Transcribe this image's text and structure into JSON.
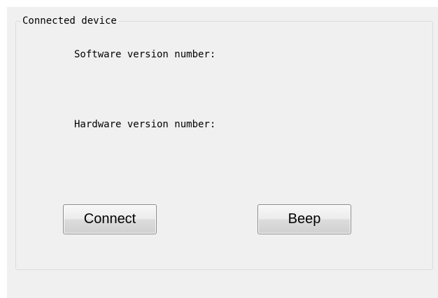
{
  "group": {
    "title": "Connected device"
  },
  "labels": {
    "software_version": "Software version number:",
    "hardware_version": "Hardware version number:"
  },
  "buttons": {
    "connect": "Connect",
    "beep": "Beep"
  }
}
